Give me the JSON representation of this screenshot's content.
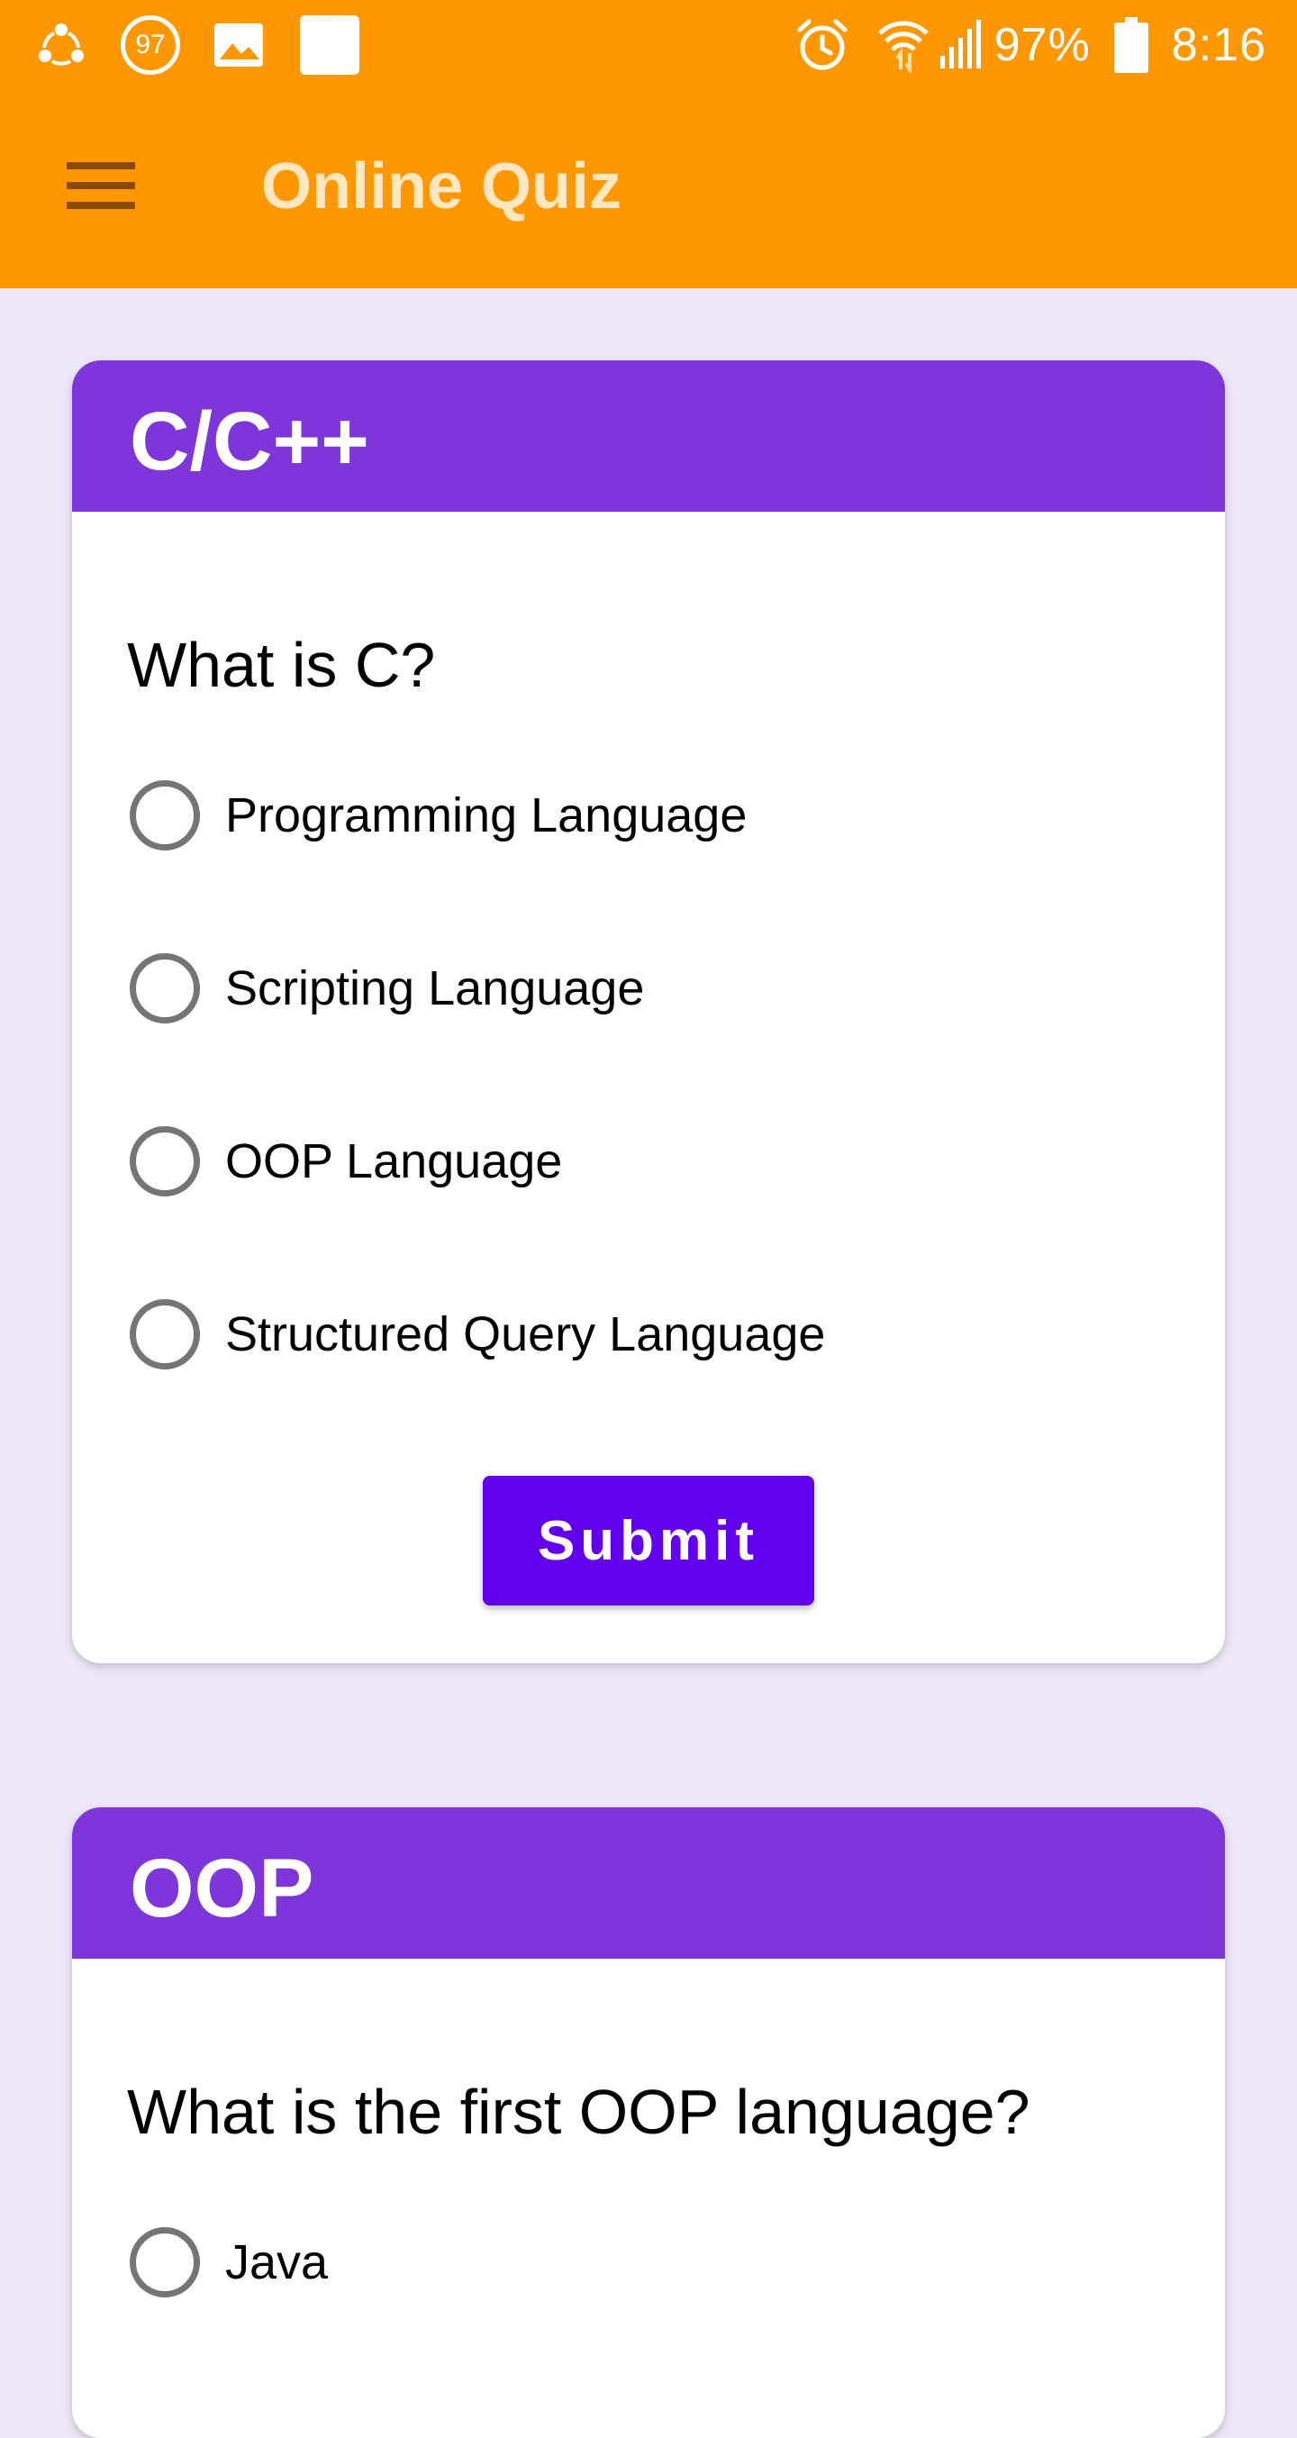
{
  "status_bar": {
    "badge": "97",
    "battery": "97%",
    "time": "8:16",
    "icons": [
      "share-icon",
      "notification-badge",
      "image-icon",
      "blank-app-icon",
      "alarm-icon",
      "wifi-icon",
      "signal-icon",
      "battery-icon"
    ]
  },
  "app_bar": {
    "title": "Online Quiz",
    "menu_icon": "hamburger-menu-icon"
  },
  "colors": {
    "app_bar": "#ff9800",
    "card_header": "#7e35d9",
    "submit_button": "#6200ee",
    "background": "#ede7f6"
  },
  "quizzes": [
    {
      "category": "C/C++",
      "question": "What is C?",
      "options": [
        "Programming Language",
        "Scripting Language",
        "OOP Language",
        "Structured Query Language"
      ],
      "submit_label": "Submit"
    },
    {
      "category": "OOP",
      "question": "What is the first OOP language?",
      "options": [
        "Java"
      ]
    }
  ]
}
